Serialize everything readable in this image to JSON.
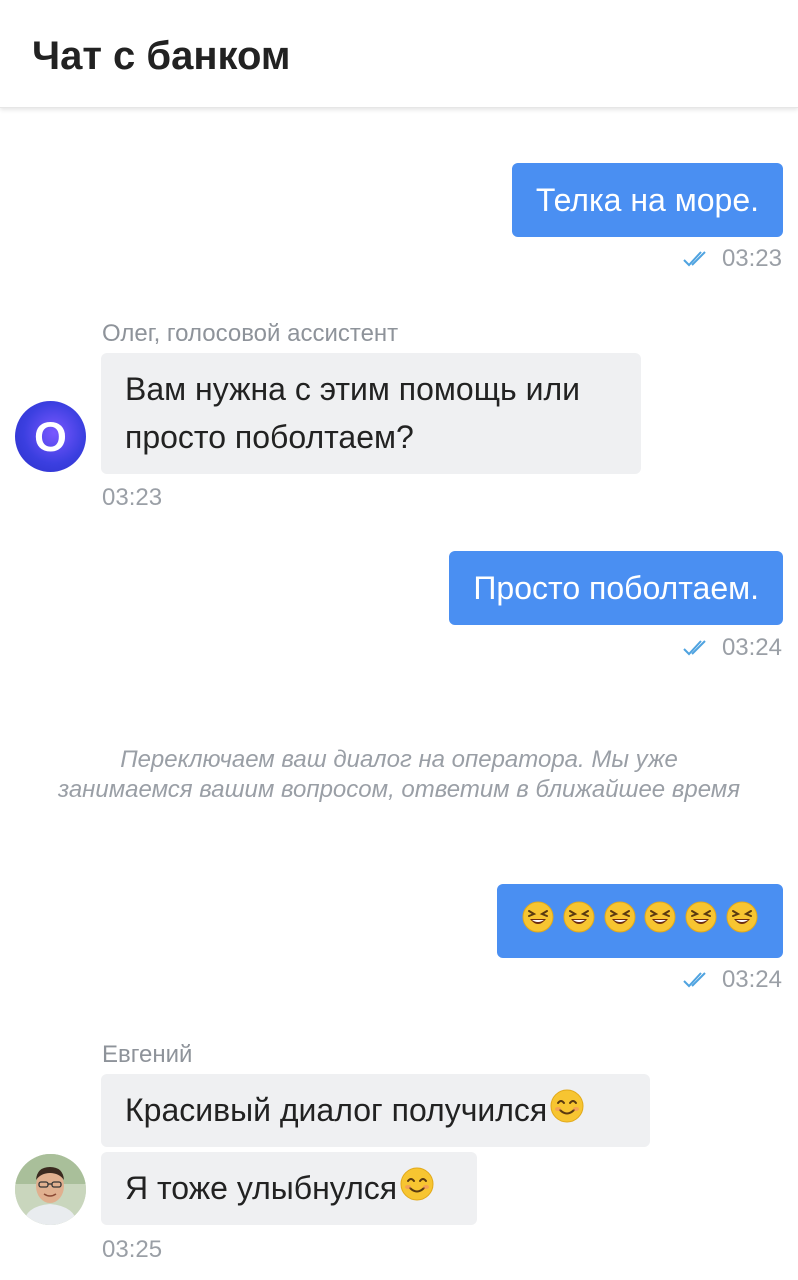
{
  "header": {
    "title": "Чат с банком"
  },
  "messages": [
    {
      "direction": "out",
      "text": "Телка на море.",
      "time": "03:23",
      "status": "read"
    },
    {
      "direction": "in",
      "sender": "Олег, голосовой ассистент",
      "avatar_letter": "O",
      "lines": [
        "Вам нужна с этим помощь или",
        "просто поболтаем?"
      ],
      "time": "03:23"
    },
    {
      "direction": "out",
      "text": "Просто поболтаем.",
      "time": "03:24",
      "status": "read"
    },
    {
      "direction": "system",
      "lines": [
        "Переключаем ваш диалог на оператора. Мы уже",
        "занимаемся вашим вопросом, ответим в ближайшее время"
      ]
    },
    {
      "direction": "out",
      "emoji": "laughing-face-emoji",
      "emoji_count": 6,
      "time": "03:24",
      "status": "read"
    },
    {
      "direction": "in",
      "sender": "Евгений",
      "texts": [
        "Красивый диалог получился",
        "Я тоже улыбнулся"
      ],
      "trailing_emoji": "smiling-face-emoji",
      "time": "03:25"
    }
  ],
  "colors": {
    "outgoing_bubble": "#4a8ff2",
    "incoming_bubble": "#eff0f2",
    "read_check": "#4fa3e0",
    "meta_text": "#9a9fa6"
  }
}
